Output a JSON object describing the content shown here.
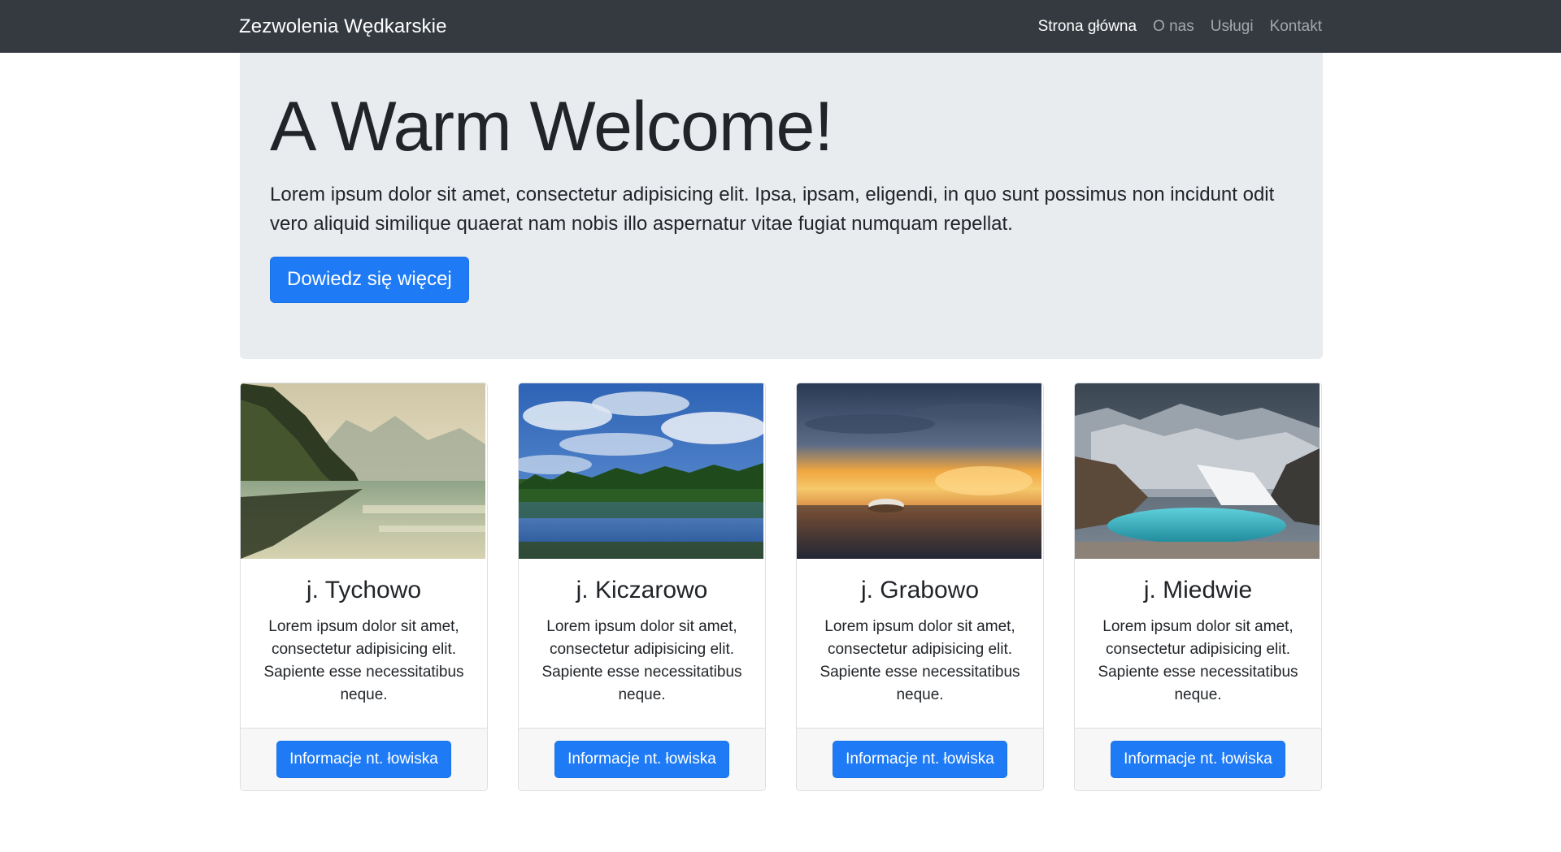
{
  "navbar": {
    "brand": "Zezwolenia Wędkarskie",
    "links": [
      "Strona główna",
      "O nas",
      "Usługi",
      "Kontakt"
    ],
    "active_index": 0
  },
  "jumbotron": {
    "title": "A Warm Welcome!",
    "lead": "Lorem ipsum dolor sit amet, consectetur adipisicing elit. Ipsa, ipsam, eligendi, in quo sunt possimus non incidunt odit vero aliquid similique quaerat nam nobis illo aspernatur vitae fugiat numquam repellat.",
    "button_label": "Dowiedz się więcej"
  },
  "cards": [
    {
      "title": "j. Tychowo",
      "text": "Lorem ipsum dolor sit amet, consectetur adipisicing elit. Sapiente esse necessitatibus neque.",
      "button_label": "Informacje nt. łowiska"
    },
    {
      "title": "j. Kiczarowo",
      "text": "Lorem ipsum dolor sit amet, consectetur adipisicing elit. Sapiente esse necessitatibus neque.",
      "button_label": "Informacje nt. łowiska"
    },
    {
      "title": "j. Grabowo",
      "text": "Lorem ipsum dolor sit amet, consectetur adipisicing elit. Sapiente esse necessitatibus neque.",
      "button_label": "Informacje nt. łowiska"
    },
    {
      "title": "j. Miedwie",
      "text": "Lorem ipsum dolor sit amet, consectetur adipisicing elit. Sapiente esse necessitatibus neque.",
      "button_label": "Informacje nt. łowiska"
    }
  ],
  "colors": {
    "navbar_bg": "#343a40",
    "jumbotron_bg": "#e9ecef",
    "primary": "#1f7bf5"
  }
}
